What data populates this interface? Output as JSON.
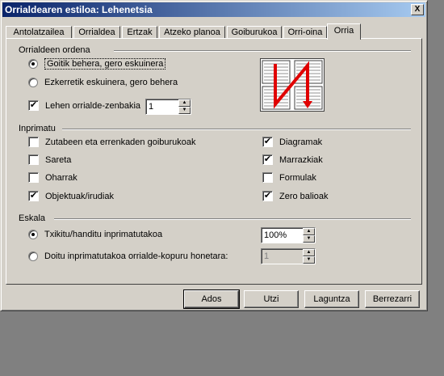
{
  "window": {
    "title": "Orrialdearen estiloa: Lehenetsia",
    "close": "X"
  },
  "tabs": [
    {
      "label": "Antolatzailea"
    },
    {
      "label": "Orrialdea"
    },
    {
      "label": "Ertzak"
    },
    {
      "label": "Atzeko planoa"
    },
    {
      "label": "Goiburukoa"
    },
    {
      "label": "Orri-oina"
    },
    {
      "label": "Orria"
    }
  ],
  "page_order": {
    "title": "Orrialdeen ordena",
    "top_bottom": "Goitik behera, gero eskuinera",
    "left_right": "Ezkerretik eskuinera, gero behera",
    "first_page": "Lehen orrialde-zenbakia",
    "first_page_value": "1"
  },
  "print": {
    "title": "Inprimatu",
    "headers": "Zutabeen eta errenkaden goiburukoak",
    "grid": "Sareta",
    "notes": "Oharrak",
    "objects": "Objektuak/irudiak",
    "charts": "Diagramak",
    "drawings": "Marrazkiak",
    "formulas": "Formulak",
    "zero": "Zero balioak",
    "checkmark": "✔"
  },
  "scale": {
    "title": "Eskala",
    "reduce": "Txikitu/handitu inprimatutakoa",
    "reduce_value": "100%",
    "fit": "Doitu inprimatutakoa orrialde-kopuru honetara:",
    "fit_value": "1"
  },
  "buttons": {
    "ok": "Ados",
    "cancel": "Utzi",
    "help": "Laguntza",
    "reset": "Berrezarri"
  },
  "icons": {
    "up": "▲",
    "down": "▼"
  },
  "colors": {
    "title_start": "#0a246a",
    "title_end": "#a6caf0",
    "dialog": "#d4d0c8",
    "preview_arrow": "#e00000"
  }
}
